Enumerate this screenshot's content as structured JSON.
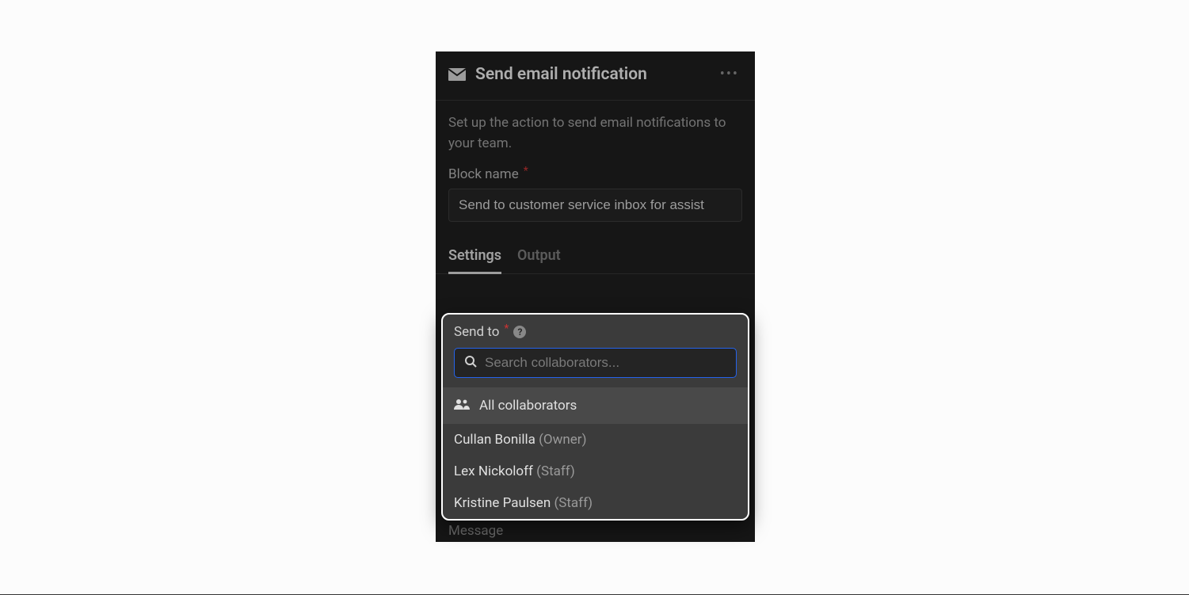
{
  "header": {
    "title": "Send email notification"
  },
  "description": "Set up the action to send email notifications to your team.",
  "block_name": {
    "label": "Block name",
    "value": "Send to customer service inbox for assist"
  },
  "tabs": {
    "settings": "Settings",
    "output": "Output",
    "active": "settings"
  },
  "send_to": {
    "label": "Send to",
    "search_placeholder": "Search collaborators...",
    "all_label": "All collaborators"
  },
  "collaborators": [
    {
      "name": "Cullan Bonilla",
      "role": "(Owner)"
    },
    {
      "name": "Lex Nickoloff",
      "role": "(Staff)"
    },
    {
      "name": "Kristine Paulsen",
      "role": "(Staff)"
    }
  ],
  "message_label": "Message"
}
